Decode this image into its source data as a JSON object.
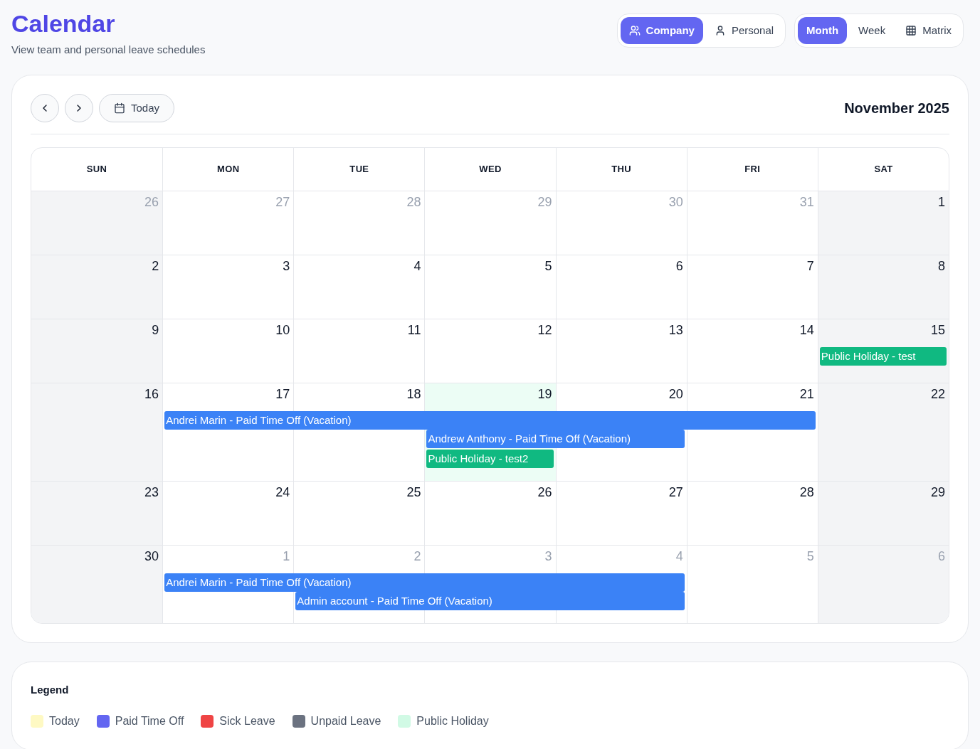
{
  "header": {
    "title": "Calendar",
    "subtitle": "View team and personal leave schedules"
  },
  "scope_tabs": [
    {
      "label": "Company",
      "selected": true
    },
    {
      "label": "Personal",
      "selected": false
    }
  ],
  "view_tabs": [
    {
      "label": "Month",
      "selected": true
    },
    {
      "label": "Week",
      "selected": false
    },
    {
      "label": "Matrix",
      "selected": false
    }
  ],
  "toolbar": {
    "today_button": "Today",
    "period": "November 2025"
  },
  "weekdays": [
    "SUN",
    "MON",
    "TUE",
    "WED",
    "THU",
    "FRI",
    "SAT"
  ],
  "weeks": [
    {
      "days": [
        {
          "label": "26",
          "muted": true
        },
        {
          "label": "27",
          "muted": true
        },
        {
          "label": "28",
          "muted": true
        },
        {
          "label": "29",
          "muted": true
        },
        {
          "label": "30",
          "muted": true
        },
        {
          "label": "31",
          "muted": true
        },
        {
          "label": "1",
          "muted": false
        }
      ]
    },
    {
      "days": [
        {
          "label": "2",
          "muted": false
        },
        {
          "label": "3",
          "muted": false
        },
        {
          "label": "4",
          "muted": false
        },
        {
          "label": "5",
          "muted": false
        },
        {
          "label": "6",
          "muted": false
        },
        {
          "label": "7",
          "muted": false
        },
        {
          "label": "8",
          "muted": false
        }
      ]
    },
    {
      "days": [
        {
          "label": "9",
          "muted": false
        },
        {
          "label": "10",
          "muted": false
        },
        {
          "label": "11",
          "muted": false
        },
        {
          "label": "12",
          "muted": false
        },
        {
          "label": "13",
          "muted": false
        },
        {
          "label": "14",
          "muted": false
        },
        {
          "label": "15",
          "muted": false
        }
      ],
      "lanes": [
        [
          {
            "kind": "empty"
          },
          {
            "kind": "empty"
          },
          {
            "kind": "empty"
          },
          {
            "kind": "empty"
          },
          {
            "kind": "empty"
          },
          {
            "kind": "empty"
          },
          {
            "kind": "public_holiday",
            "label": "Public Holiday - test"
          }
        ]
      ]
    },
    {
      "days": [
        {
          "label": "16",
          "muted": false
        },
        {
          "label": "17",
          "muted": false
        },
        {
          "label": "18",
          "muted": false
        },
        {
          "label": "19",
          "muted": false,
          "holiday": true
        },
        {
          "label": "20",
          "muted": false
        },
        {
          "label": "21",
          "muted": false
        },
        {
          "label": "22",
          "muted": false
        }
      ],
      "lanes": [
        [
          {
            "kind": "empty"
          },
          {
            "kind": "paid_time_off",
            "label": "Andrei Marin - Paid Time Off (Vacation)"
          },
          {
            "kind": "continued"
          },
          {
            "kind": "continued"
          },
          {
            "kind": "continued"
          },
          {
            "kind": "continued"
          }
        ],
        [
          {
            "kind": "empty"
          },
          {
            "kind": "empty"
          },
          {
            "kind": "empty"
          },
          {
            "kind": "paid_time_off",
            "label": "Andrew Anthony - Paid Time Off (Vacation)"
          },
          {
            "kind": "continued"
          }
        ],
        [
          {
            "kind": "empty"
          },
          {
            "kind": "empty"
          },
          {
            "kind": "empty"
          },
          {
            "kind": "public_holiday",
            "label": "Public Holiday - test2"
          }
        ]
      ]
    },
    {
      "days": [
        {
          "label": "23",
          "muted": false
        },
        {
          "label": "24",
          "muted": false
        },
        {
          "label": "25",
          "muted": false
        },
        {
          "label": "26",
          "muted": false
        },
        {
          "label": "27",
          "muted": false
        },
        {
          "label": "28",
          "muted": false
        },
        {
          "label": "29",
          "muted": false
        }
      ]
    },
    {
      "days": [
        {
          "label": "30",
          "muted": false
        },
        {
          "label": "1",
          "muted": true
        },
        {
          "label": "2",
          "muted": true
        },
        {
          "label": "3",
          "muted": true
        },
        {
          "label": "4",
          "muted": true
        },
        {
          "label": "5",
          "muted": true
        },
        {
          "label": "6",
          "muted": true
        }
      ],
      "lanes": [
        [
          {
            "kind": "empty"
          },
          {
            "kind": "paid_time_off",
            "label": "Andrei Marin - Paid Time Off (Vacation)"
          },
          {
            "kind": "continued"
          },
          {
            "kind": "continued"
          },
          {
            "kind": "continued"
          }
        ],
        [
          {
            "kind": "empty"
          },
          {
            "kind": "empty"
          },
          {
            "kind": "paid_time_off",
            "label": "Admin account - Paid Time Off (Vacation)"
          },
          {
            "kind": "continued"
          },
          {
            "kind": "continued"
          }
        ]
      ]
    }
  ],
  "legend": {
    "title": "Legend",
    "items": [
      {
        "label": "Today",
        "color": "#fef9c3"
      },
      {
        "label": "Paid Time Off",
        "color": "#6366f1"
      },
      {
        "label": "Sick Leave",
        "color": "#ef4444"
      },
      {
        "label": "Unpaid Leave",
        "color": "#6b7280"
      },
      {
        "label": "Public Holiday",
        "color": "#d1fae5"
      }
    ]
  }
}
